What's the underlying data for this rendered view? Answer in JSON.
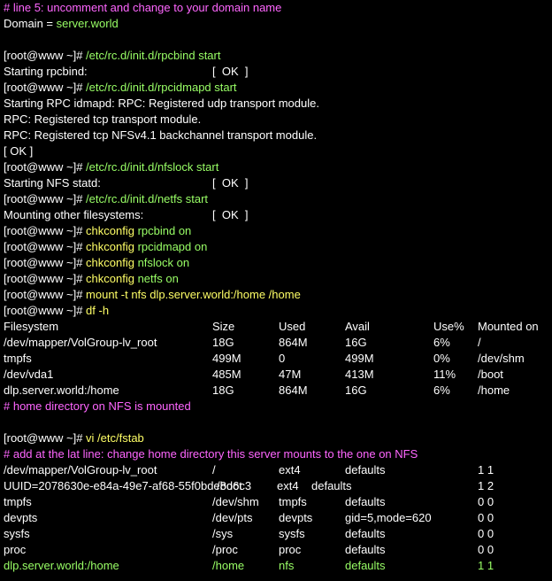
{
  "colors": {
    "background": "#000000",
    "text": "#ffffff",
    "comment": "#ff66ff",
    "command": "#99ff66",
    "chkconfig": "#ffff66"
  },
  "lines": [
    {
      "kind": "text",
      "segments": [
        {
          "t": "# line 5: uncomment and change to your domain name",
          "c": "magenta"
        }
      ]
    },
    {
      "kind": "text",
      "segments": [
        {
          "t": "Domain = ",
          "c": "white"
        },
        {
          "t": "server.world",
          "c": "green"
        }
      ]
    },
    {
      "kind": "blank"
    },
    {
      "kind": "text",
      "segments": [
        {
          "t": "[root@www ~]# ",
          "c": "white"
        },
        {
          "t": "/etc/rc.d/init.d/rpcbind start",
          "c": "green"
        }
      ]
    },
    {
      "kind": "status",
      "label": "Starting rpcbind:",
      "status": "[  OK  ]"
    },
    {
      "kind": "text",
      "segments": [
        {
          "t": "[root@www ~]# ",
          "c": "white"
        },
        {
          "t": "/etc/rc.d/init.d/rpcidmapd start",
          "c": "green"
        }
      ]
    },
    {
      "kind": "text",
      "segments": [
        {
          "t": "Starting RPC idmapd: RPC: Registered udp transport module.",
          "c": "white"
        }
      ]
    },
    {
      "kind": "text",
      "segments": [
        {
          "t": "RPC: Registered tcp transport module.",
          "c": "white"
        }
      ]
    },
    {
      "kind": "text",
      "segments": [
        {
          "t": "RPC: Registered tcp NFSv4.1 backchannel transport module.",
          "c": "white"
        }
      ]
    },
    {
      "kind": "text",
      "segments": [
        {
          "t": "[ OK ]",
          "c": "white"
        }
      ]
    },
    {
      "kind": "text",
      "segments": [
        {
          "t": "[root@www ~]# ",
          "c": "white"
        },
        {
          "t": "/etc/rc.d/init.d/nfslock start",
          "c": "green"
        }
      ]
    },
    {
      "kind": "status",
      "label": "Starting NFS statd:",
      "status": "[  OK  ]"
    },
    {
      "kind": "text",
      "segments": [
        {
          "t": "[root@www ~]# ",
          "c": "white"
        },
        {
          "t": "/etc/rc.d/init.d/netfs start",
          "c": "green"
        }
      ]
    },
    {
      "kind": "status",
      "label": "Mounting other filesystems:",
      "status": "[  OK  ]"
    },
    {
      "kind": "text",
      "segments": [
        {
          "t": "[root@www ~]# ",
          "c": "white"
        },
        {
          "t": "chkconfig",
          "c": "yellow"
        },
        {
          "t": " rpcbind on",
          "c": "green"
        }
      ]
    },
    {
      "kind": "text",
      "segments": [
        {
          "t": "[root@www ~]# ",
          "c": "white"
        },
        {
          "t": "chkconfig",
          "c": "yellow"
        },
        {
          "t": " rpcidmapd on",
          "c": "green"
        }
      ]
    },
    {
      "kind": "text",
      "segments": [
        {
          "t": "[root@www ~]# ",
          "c": "white"
        },
        {
          "t": "chkconfig",
          "c": "yellow"
        },
        {
          "t": " nfslock on",
          "c": "green"
        }
      ]
    },
    {
      "kind": "text",
      "segments": [
        {
          "t": "[root@www ~]# ",
          "c": "white"
        },
        {
          "t": "chkconfig",
          "c": "yellow"
        },
        {
          "t": " netfs on",
          "c": "green"
        }
      ]
    },
    {
      "kind": "text",
      "segments": [
        {
          "t": "[root@www ~]# ",
          "c": "white"
        },
        {
          "t": "mount -t nfs dlp.server.world:/home /home",
          "c": "yellow"
        }
      ]
    },
    {
      "kind": "text",
      "segments": [
        {
          "t": "[root@www ~]# ",
          "c": "white"
        },
        {
          "t": "df -h",
          "c": "yellow"
        }
      ]
    },
    {
      "kind": "df",
      "cols": [
        "Filesystem",
        "Size",
        "Used",
        "Avail",
        "Use%",
        "Mounted on"
      ],
      "c": "white"
    },
    {
      "kind": "df",
      "cols": [
        "/dev/mapper/VolGroup-lv_root",
        "18G",
        "864M",
        "16G",
        "6%",
        "/"
      ],
      "c": "white"
    },
    {
      "kind": "df",
      "cols": [
        "tmpfs",
        "499M",
        "0",
        "499M",
        "0%",
        "/dev/shm"
      ],
      "c": "white"
    },
    {
      "kind": "df",
      "cols": [
        "/dev/vda1",
        "485M",
        "47M",
        "413M",
        "11%",
        "/boot"
      ],
      "c": "white"
    },
    {
      "kind": "df",
      "cols": [
        "dlp.server.world:/home",
        "18G",
        "864M",
        "16G",
        "6%",
        "/home"
      ],
      "c": "white"
    },
    {
      "kind": "text",
      "segments": [
        {
          "t": "# home directory on NFS is mounted",
          "c": "magenta"
        }
      ]
    },
    {
      "kind": "blank"
    },
    {
      "kind": "text",
      "segments": [
        {
          "t": "[root@www ~]# ",
          "c": "white"
        },
        {
          "t": "vi /etc/fstab",
          "c": "yellow"
        }
      ]
    },
    {
      "kind": "text",
      "segments": [
        {
          "t": "# add at the lat line: change home directory this server mounts to the one on NFS",
          "c": "magenta"
        }
      ]
    },
    {
      "kind": "fstab",
      "cols": [
        "/dev/mapper/VolGroup-lv_root",
        "/",
        "ext4",
        "defaults",
        "1 1"
      ],
      "c": "white"
    },
    {
      "kind": "uuid",
      "cols": [
        "UUID=2078630e-e84a-49e7-af68-55f0bde8d6c3",
        "/boot",
        "ext4",
        "defaults",
        "1 2"
      ],
      "c": "white"
    },
    {
      "kind": "fstab",
      "cols": [
        "tmpfs",
        "/dev/shm",
        "tmpfs",
        "defaults",
        "0 0"
      ],
      "c": "white"
    },
    {
      "kind": "fstab",
      "cols": [
        "devpts",
        "/dev/pts",
        "devpts",
        "gid=5,mode=620",
        "0 0"
      ],
      "c": "white"
    },
    {
      "kind": "fstab",
      "cols": [
        "sysfs",
        "/sys",
        "sysfs",
        "defaults",
        "0 0"
      ],
      "c": "white"
    },
    {
      "kind": "fstab",
      "cols": [
        "proc",
        "/proc",
        "proc",
        "defaults",
        "0 0"
      ],
      "c": "white"
    },
    {
      "kind": "fstab",
      "cols": [
        "dlp.server.world:/home",
        "/home",
        "nfs",
        "defaults",
        "1 1"
      ],
      "c": "green"
    }
  ]
}
